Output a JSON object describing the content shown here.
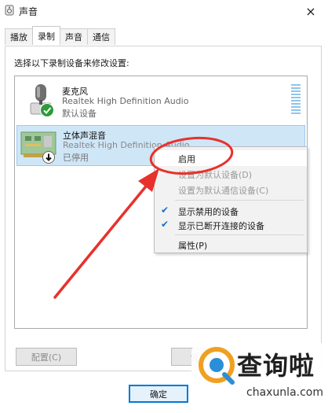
{
  "window": {
    "title": "声音",
    "close_glyph": "×"
  },
  "tabs": [
    {
      "label": "播放",
      "active": false
    },
    {
      "label": "录制",
      "active": true
    },
    {
      "label": "声音",
      "active": false
    },
    {
      "label": "通信",
      "active": false
    }
  ],
  "instruction": "选择以下录制设备来修改设置:",
  "devices": [
    {
      "name": "麦克风",
      "driver": "Realtek High Definition Audio",
      "status": "默认设备",
      "icon": "microphone-icon",
      "badge": "default-check-icon",
      "selected": false
    },
    {
      "name": "立体声混音",
      "driver": "Realtek High Definition Audio",
      "status": "已停用",
      "icon": "stereo-mix-board-icon",
      "badge": "disabled-down-arrow-icon",
      "selected": true
    }
  ],
  "context_menu": {
    "items": [
      {
        "label": "启用",
        "enabled": true,
        "checked": false
      },
      {
        "label": "设置为默认设备(D)",
        "enabled": false,
        "checked": false
      },
      {
        "label": "设置为默认通信设备(C)",
        "enabled": false,
        "checked": false
      },
      {
        "label": "显示禁用的设备",
        "enabled": true,
        "checked": true
      },
      {
        "label": "显示已断开连接的设备",
        "enabled": true,
        "checked": true
      },
      {
        "label": "属性(P)",
        "enabled": true,
        "checked": false
      }
    ]
  },
  "buttons": {
    "configure": "配置(C)",
    "set_default": "设",
    "ok": "确定"
  },
  "watermark": {
    "name": "查询啦",
    "url": "chaxunla.com"
  },
  "colors": {
    "annotation_red": "#e8312c",
    "selection": "#cfe6f7",
    "check": "#1a6fc7",
    "primary_border": "#0078d7"
  }
}
